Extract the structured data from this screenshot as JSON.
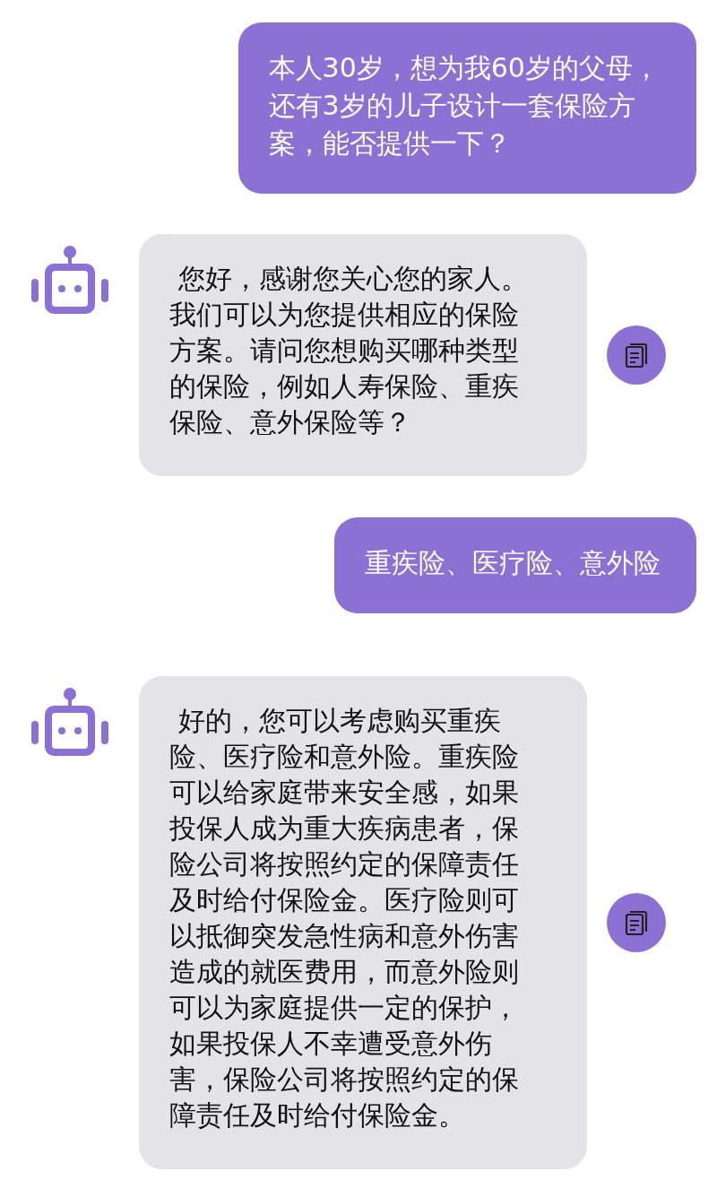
{
  "messages": [
    {
      "kind": "user",
      "text": "本人30岁，想为我60岁的父母，还有3岁的儿子设计一套保险方案，能否提供一下？"
    },
    {
      "kind": "bot",
      "text": " 您好，感谢您关心您的家人。我们可以为您提供相应的保险方案。请问您想购买哪种类型的保险，例如人寿保险、重疾保险、意外保险等？"
    },
    {
      "kind": "user",
      "text": "重疾险、医疗险、意外险"
    },
    {
      "kind": "bot",
      "text": " 好的，您可以考虑购买重疾险、医疗险和意外险。重疾险可以给家庭带来安全感，如果投保人成为重大疾病患者，保险公司将按照约定的保障责任及时给付保险金。医疗险则可以抵御突发急性病和意外伤害造成的就医费用，而意外险则可以为家庭提供一定的保护，如果投保人不幸遭受意外伤害，保险公司将按照约定的保障责任及时给付保险金。"
    }
  ]
}
